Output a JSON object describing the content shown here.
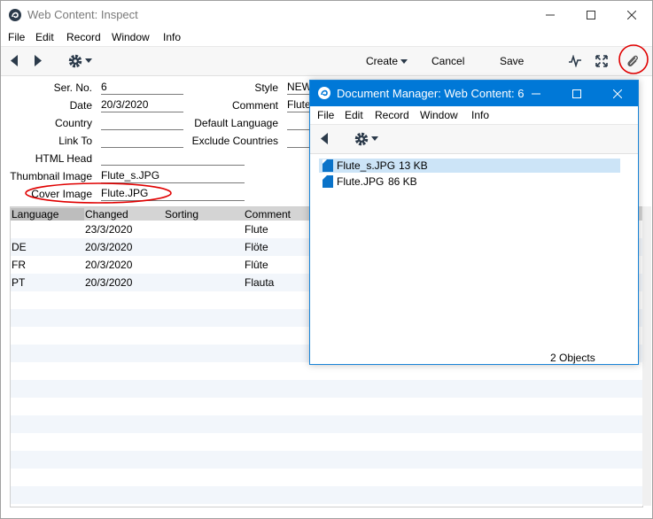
{
  "main_window": {
    "title": "Web Content: Inspect",
    "menu": [
      "File",
      "Edit",
      "Record",
      "Window",
      "Info"
    ],
    "toolbar": {
      "create_label": "Create",
      "cancel_label": "Cancel",
      "save_label": "Save"
    },
    "fields": {
      "ser_no": {
        "label": "Ser. No.",
        "value": "6"
      },
      "date": {
        "label": "Date",
        "value": "20/3/2020"
      },
      "country": {
        "label": "Country",
        "value": ""
      },
      "link_to": {
        "label": "Link To",
        "value": ""
      },
      "html_head": {
        "label": "HTML Head",
        "value": ""
      },
      "thumbnail_image": {
        "label": "Thumbnail Image",
        "value": "Flute_s.JPG"
      },
      "cover_image": {
        "label": "Cover Image",
        "value": "Flute.JPG"
      },
      "style": {
        "label": "Style",
        "value": "NEWS"
      },
      "comment": {
        "label": "Comment",
        "value": "Flute"
      },
      "default_language": {
        "label": "Default Language",
        "value": ""
      },
      "exclude_countries": {
        "label": "Exclude Countries",
        "value": ""
      }
    },
    "grid": {
      "columns": [
        "Language",
        "Changed",
        "Sorting",
        "Comment"
      ],
      "rows": [
        {
          "language": "",
          "changed": "23/3/2020",
          "sorting": "",
          "comment": "Flute"
        },
        {
          "language": "DE",
          "changed": "20/3/2020",
          "sorting": "",
          "comment": "Flöte"
        },
        {
          "language": "FR",
          "changed": "20/3/2020",
          "sorting": "",
          "comment": "Flûte"
        },
        {
          "language": "PT",
          "changed": "20/3/2020",
          "sorting": "",
          "comment": "Flauta"
        }
      ]
    }
  },
  "document_manager": {
    "title": "Document Manager: Web Content: 6",
    "menu": [
      "File",
      "Edit",
      "Record",
      "Window",
      "Info"
    ],
    "files": [
      {
        "name": "Flute_s.JPG",
        "size": "13 KB"
      },
      {
        "name": "Flute.JPG",
        "size": "86 KB"
      }
    ],
    "status": "2 Objects"
  },
  "colors": {
    "accent": "#0078d7",
    "highlight_circle": "#e00000",
    "selection": "#cce4f7"
  },
  "icons": [
    "app-logo-icon",
    "back-arrow-icon",
    "forward-arrow-icon",
    "gear-icon",
    "chevron-down-icon",
    "activity-icon",
    "expand-icon",
    "paperclip-icon",
    "doc-icon"
  ]
}
